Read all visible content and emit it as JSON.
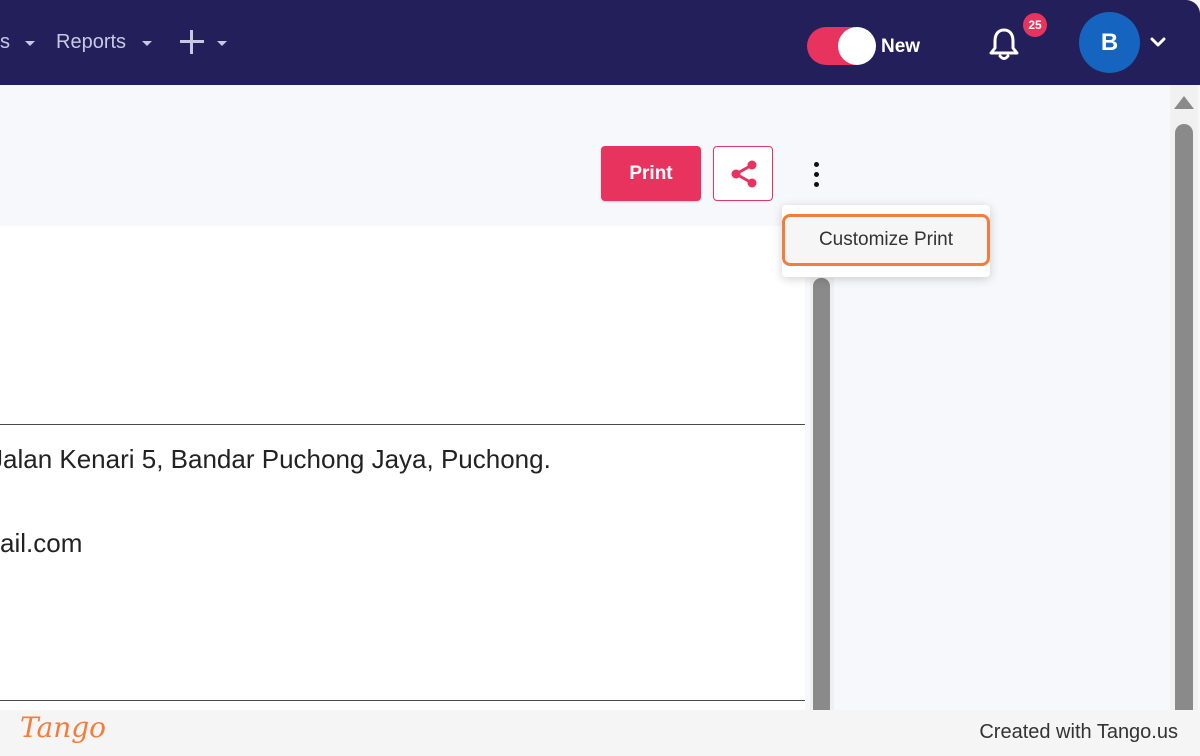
{
  "header": {
    "nav_fragment": "s",
    "reports_label": "Reports",
    "toggle_label": "New",
    "notification_count": "25",
    "avatar_initial": "B"
  },
  "toolbar": {
    "print_label": "Print"
  },
  "menu": {
    "customize_print_label": "Customize Print"
  },
  "document": {
    "address_line": "Jalan Kenari 5, Bandar Puchong Jaya, Puchong.",
    "email_line": "ail.com"
  },
  "footer": {
    "brand": "Tango",
    "credit": "Created with Tango.us"
  },
  "colors": {
    "navbar": "#221f5a",
    "accent": "#e8335f",
    "highlight": "#f47c3c",
    "avatar": "#1565c0"
  }
}
